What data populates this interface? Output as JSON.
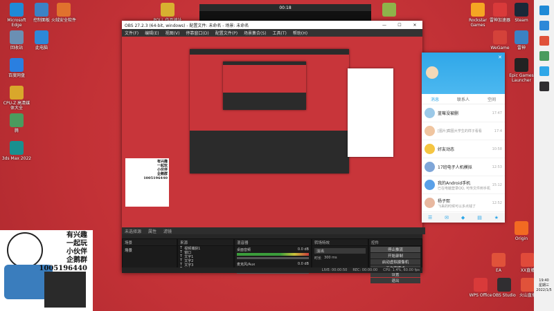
{
  "desktop_icons_left": [
    {
      "label": "Microsoft Edge",
      "icon": "edge-icon",
      "color": "#1f8ad6"
    },
    {
      "label": "控制面板",
      "icon": "control-panel-icon",
      "color": "#3b82c4"
    },
    {
      "label": "火绒安全软件",
      "icon": "huorong-icon",
      "color": "#e0722d"
    },
    {
      "label": "回收站",
      "icon": "recycle-bin-icon",
      "color": "#6b8fb3"
    },
    {
      "label": "此电脑",
      "icon": "this-pc-icon",
      "color": "#2d88d8"
    },
    {
      "label": "百度网盘",
      "icon": "baidu-netdisk-icon",
      "color": "#2a7fe0"
    },
    {
      "label": "CPU-Z 高清媒体大全",
      "icon": "cpuz-icon",
      "color": "#d9a72b"
    },
    {
      "label": "腾",
      "icon": "tencent-icon",
      "color": "#4a9b5e"
    },
    {
      "label": "3ds Max 2022",
      "icon": "3dsmax-icon",
      "color": "#1a8f8f"
    }
  ],
  "desktop_icons_top": [
    {
      "label": "POLL 作品地址",
      "icon": "poll-icon",
      "color": "#d8b030"
    },
    {
      "label": "",
      "icon": "app-icon",
      "color": "#8fb34a"
    }
  ],
  "desktop_icons_right": [
    {
      "label": "Rockstar Games",
      "icon": "rockstar-icon",
      "color": "#f5a623"
    },
    {
      "label": "雷神加速器",
      "icon": "leishen-icon",
      "color": "#d93a3a"
    },
    {
      "label": "Steam",
      "icon": "steam-icon",
      "color": "#1b2838"
    },
    {
      "label": "WeGame",
      "icon": "wegame-icon",
      "color": "#d4423a"
    },
    {
      "label": "雷神",
      "icon": "thunder-icon",
      "color": "#3b82c4"
    },
    {
      "label": "Epic Games Launcher",
      "icon": "epic-icon",
      "color": "#222222"
    },
    {
      "label": "Origin",
      "icon": "origin-icon",
      "color": "#f26a22"
    },
    {
      "label": "WPS Office",
      "icon": "wps-icon",
      "color": "#d93a3a"
    },
    {
      "label": "OBS Studio",
      "icon": "obs-icon",
      "color": "#302e31"
    },
    {
      "label": "火山直播",
      "icon": "huoshan-live-icon",
      "color": "#e0523a"
    },
    {
      "label": "XX直播",
      "icon": "live-icon",
      "color": "#e04a3a"
    },
    {
      "label": "EA",
      "icon": "ea-icon",
      "color": "#e0523a"
    }
  ],
  "pip_window": {
    "time": "00:18"
  },
  "obs": {
    "title": "OBS 27.2.3 (64-bit, windows) - 配置文件: 未命名 - 场景: 未命名",
    "menu": [
      "文件(F)",
      "编辑(E)",
      "视图(V)",
      "停靠窗口(D)",
      "配置文件(P)",
      "场景集合(S)",
      "工具(T)",
      "帮助(H)"
    ],
    "tabs": [
      "未选择源",
      "属性",
      "滤镜"
    ],
    "panels": {
      "scenes": "场景",
      "sources": "来源",
      "mixer": "混音器",
      "transitions": "转场特效",
      "controls": "控件"
    },
    "scene_item": "场景",
    "sources": [
      "视频捕获1",
      "窗口",
      "文字1",
      "文字2",
      "文字3",
      "文字4"
    ],
    "mixer_tracks": [
      {
        "name": "桌面音频",
        "db": "0.0 dB"
      },
      {
        "name": "麦克风/Aux",
        "db": "0.0 dB"
      }
    ],
    "transition": {
      "value": "淡出",
      "duration_label": "时长",
      "duration": "300 ms"
    },
    "controls": [
      "停止推流",
      "开始录制",
      "启动虚拟摄像机",
      "工作室模式",
      "设置",
      "退出"
    ],
    "status": {
      "live": "LIVE: 00:00:50",
      "rec": "REC: 00:00:00",
      "cpu": "CPU: 1.4%, 60.00 fps"
    }
  },
  "qq": {
    "tabs": [
      "消息",
      "联系人",
      "空间"
    ],
    "rows": [
      {
        "name": "蓝莓没被删",
        "msg": "",
        "time": "17:47"
      },
      {
        "name": "",
        "msg": "[图片]截图大学生的样子看看",
        "time": "17:4"
      },
      {
        "name": "好友动态",
        "msg": "",
        "time": "10:58"
      },
      {
        "name": "17班电子人机模拟",
        "msg": "",
        "time": "12:53"
      },
      {
        "name": "我的Android手机",
        "msg": "已在电脑登录QQ, 可传文件到手机",
        "time": "15:12"
      },
      {
        "name": "杨子熙",
        "msg": "飞来的时候可以多点钱了",
        "time": "12:52"
      }
    ]
  },
  "cartoon": {
    "lines": [
      "有兴趣",
      "一起玩",
      "小伙伴",
      "企鹅群",
      "1005196440"
    ]
  },
  "clock": {
    "time": "19:40",
    "day": "星期三",
    "date": "2022/1/5"
  },
  "colors": {
    "desktop_bg": "#c9353a",
    "obs_bg": "#2b2b2b",
    "qq_accent": "#2fa7e8"
  }
}
